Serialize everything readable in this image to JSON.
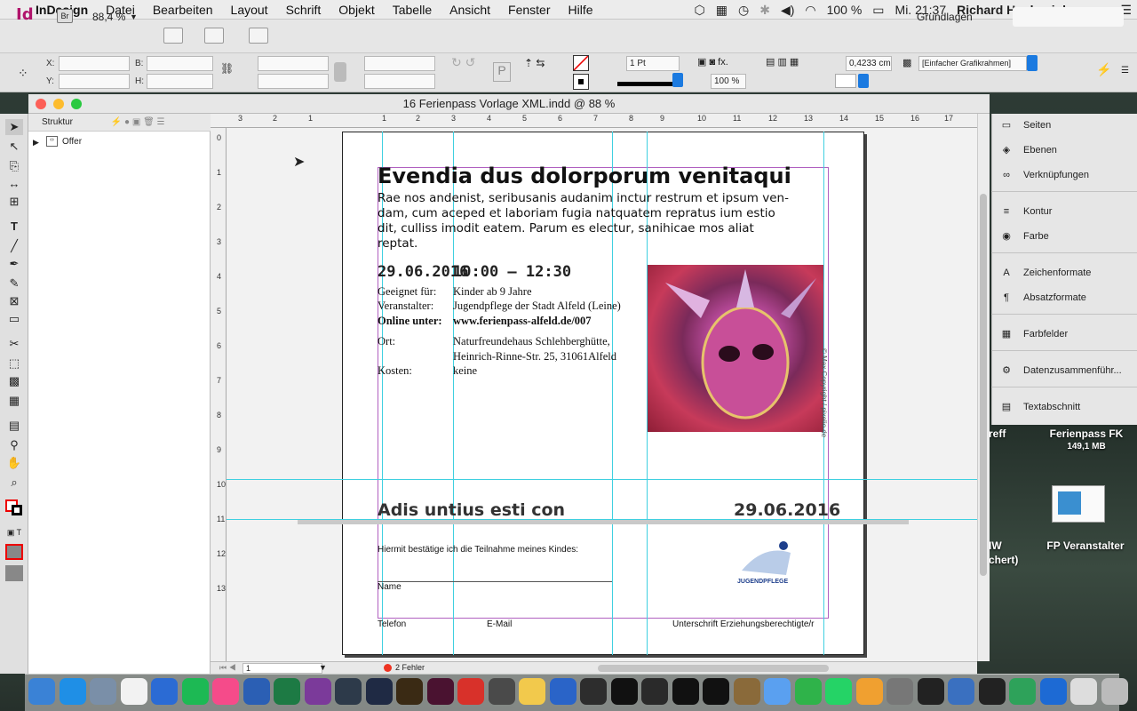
{
  "menubar": {
    "app": "InDesign",
    "items": [
      "Datei",
      "Bearbeiten",
      "Layout",
      "Schrift",
      "Objekt",
      "Tabelle",
      "Ansicht",
      "Fenster",
      "Hilfe"
    ],
    "battery": "100 %",
    "clock": "Mi. 21:37",
    "user": "Richard Henkenjohann"
  },
  "control": {
    "app_logo": "Id",
    "bridge": "Br",
    "zoom": "88,4 %",
    "workspace": "Grundlagen",
    "x_label": "X:",
    "y_label": "Y:",
    "b_label": "B:",
    "h_label": "H:",
    "stroke_weight": "1 Pt",
    "scale": "100 %",
    "ref_value": "0,4233 cm",
    "frame_style": "[Einfacher Grafikrahmen]"
  },
  "window": {
    "title": "16 Ferienpass Vorlage XML.indd @ 88 %"
  },
  "structure": {
    "title": "Struktur",
    "root": "Offer"
  },
  "rulers": {
    "top": [
      "3",
      "2",
      "1",
      "1",
      "2",
      "3",
      "4",
      "5",
      "6",
      "7",
      "8",
      "9",
      "10",
      "11",
      "12",
      "13",
      "14",
      "15",
      "16",
      "17"
    ],
    "left": [
      "0",
      "1",
      "2",
      "3",
      "4",
      "5",
      "6",
      "7",
      "8",
      "9",
      "10",
      "11",
      "12",
      "13"
    ]
  },
  "doc": {
    "heading": "Evendia dus dolorporum venitaqui",
    "intro": "Rae nos andenist, seribusanis audanim inctur restrum et ipsum ven-dam, cum aceped et laboriam fugia natquatem repratus ium estio dit, culliss imodit eatem. Parum es electur, sanihicae mos aliat reptat.",
    "date": "29.06.2016",
    "time": "10:00 – 12:30",
    "rows": [
      {
        "k": "Geeignet für:",
        "v": "Kinder ab 9 Jahre",
        "bold": false
      },
      {
        "k": "Veranstalter:",
        "v": "Jugendpflege der Stadt Alfeld (Leine)",
        "bold": false
      },
      {
        "k": "Online unter:",
        "v": "www.ferienpass-alfeld.de/007",
        "bold": true
      },
      {
        "k": "Ort:",
        "v": "Naturfreundehaus Schlehberghütte,",
        "bold": false
      },
      {
        "k": "",
        "v": "Heinrich-Rinne-Str. 25, 31061Alfeld",
        "bold": false
      },
      {
        "k": "Kosten:",
        "v": "keine",
        "bold": false
      }
    ],
    "photo_credit": "© Max Copyright / pixelio.de",
    "sub_heading": "Adis untius esti con",
    "sub_date": "29.06.2016",
    "consent": "Hiermit bestätige ich die Teilnahme meines Kindes:",
    "name": "Name",
    "phone": "Telefon",
    "email": "E-Mail",
    "signature": "Unterschrift Erziehungsberechtigte/r",
    "logo_text": "JUGENDPFLEGE"
  },
  "panels": [
    "Seiten",
    "Ebenen",
    "Verknüpfungen",
    "Kontur",
    "Farbe",
    "Zeichenformate",
    "Absatzformate",
    "Farbfelder",
    "Datenzusammenführ...",
    "Textabschnitt"
  ],
  "status": {
    "page": "1",
    "errors": "2 Fehler"
  },
  "desktop": {
    "file1_name": "Ferienpass FK",
    "file1_size": "149,1 MB",
    "file2_name": "FP Veranstalter",
    "partial1": "reff",
    "partial2": "IW",
    "partial3": "chert)"
  },
  "dock": [
    "Finder",
    "Safari",
    "Preview",
    "Kalender",
    "Calc",
    "Spotify",
    "iTunes",
    "Word",
    "Excel",
    "OneNote",
    "Lr",
    "Ps",
    "Ai",
    "Id",
    "Acrobat",
    "Mail",
    "Notes",
    "1P",
    "Term",
    "PS",
    "DG",
    "IJ",
    "WS",
    "Box",
    "Msg",
    "FaceTime",
    "WhatsApp",
    "Photos",
    "Prefs",
    "Curve",
    "Mail2",
    "Activity",
    "Atom",
    "Edge",
    "Docs",
    "Trash"
  ]
}
